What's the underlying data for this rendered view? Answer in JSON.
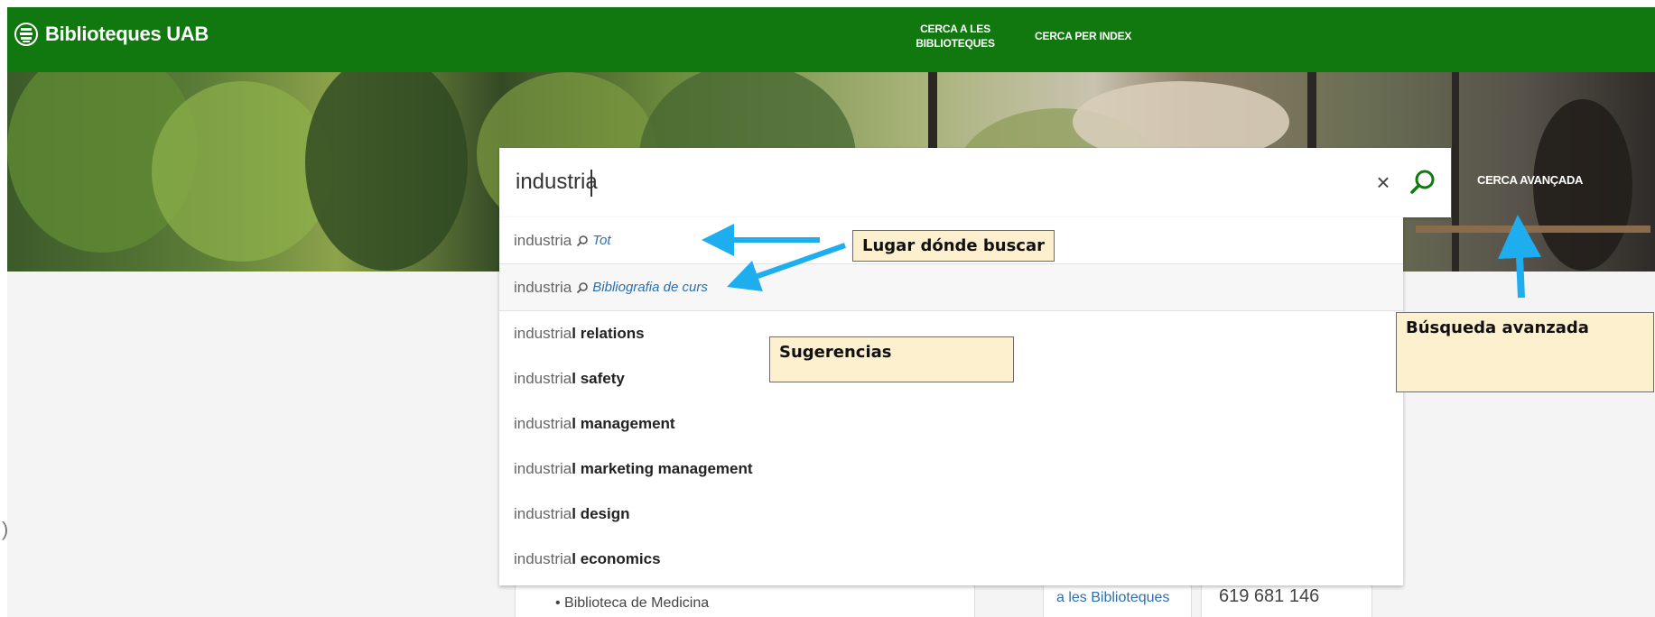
{
  "header": {
    "logo_text": "Biblioteques UAB",
    "nav": [
      "CERCA A LES BIBLIOTEQUES",
      "CERCA PER INDEX"
    ]
  },
  "search": {
    "value": "industria",
    "clear_glyph": "×",
    "advanced_label": "CERCA AVANÇADA"
  },
  "scopes": [
    {
      "query": "industria",
      "scope": "Tot"
    },
    {
      "query": "industria",
      "scope": "Bibliografia de curs"
    }
  ],
  "suggestions": [
    {
      "prefix": "industria",
      "rest": "l relations"
    },
    {
      "prefix": "industria",
      "rest": "l safety"
    },
    {
      "prefix": "industria",
      "rest": "l management"
    },
    {
      "prefix": "industria",
      "rest": "l marketing management"
    },
    {
      "prefix": "industria",
      "rest": "l design"
    },
    {
      "prefix": "industria",
      "rest": "l economics"
    }
  ],
  "annotations": {
    "scope_note": "Lugar dónde buscar",
    "suggest_note": "Sugerencias",
    "advanced_note": "Búsqueda avanzada"
  },
  "background": {
    "bullet_item": "• Biblioteca de Medicina",
    "link_text": "a les Biblioteques",
    "phone": "619 681 146"
  },
  "colors": {
    "header_green": "#11780f",
    "arrow_blue": "#1eaef0",
    "note_bg": "#fdf0cf",
    "scope_link": "#2c6fb0"
  },
  "icons": [
    "library-logo-icon",
    "search-icon",
    "close-icon",
    "magnifier-icon"
  ]
}
